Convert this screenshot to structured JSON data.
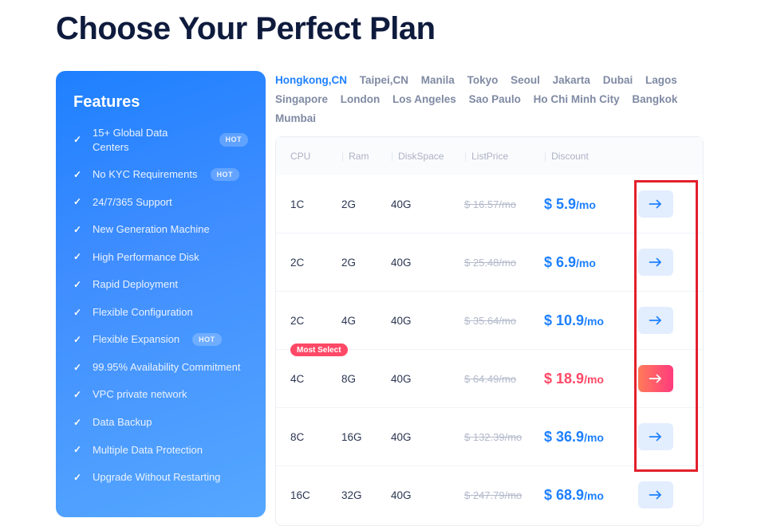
{
  "title": "Choose Your Perfect Plan",
  "features": {
    "heading": "Features",
    "hot_label": "HOT",
    "items": [
      {
        "label": "15+ Global Data Centers",
        "hot": true
      },
      {
        "label": "No KYC Requirements",
        "hot": true
      },
      {
        "label": "24/7/365 Support",
        "hot": false
      },
      {
        "label": "New Generation Machine",
        "hot": false
      },
      {
        "label": "High Performance Disk",
        "hot": false
      },
      {
        "label": "Rapid Deployment",
        "hot": false
      },
      {
        "label": "Flexible Configuration",
        "hot": false
      },
      {
        "label": "Flexible Expansion",
        "hot": true
      },
      {
        "label": "99.95% Availability Commitment",
        "hot": false
      },
      {
        "label": "VPC private network",
        "hot": false
      },
      {
        "label": "Data Backup",
        "hot": false
      },
      {
        "label": "Multiple Data Protection",
        "hot": false
      },
      {
        "label": "Upgrade Without Restarting",
        "hot": false
      }
    ]
  },
  "locations": {
    "active": 0,
    "items": [
      "Hongkong,CN",
      "Taipei,CN",
      "Manila",
      "Tokyo",
      "Seoul",
      "Jakarta",
      "Dubai",
      "Lagos",
      "Singapore",
      "London",
      "Los Angeles",
      "Sao Paulo",
      "Ho Chi Minh City",
      "Bangkok",
      "Mumbai"
    ]
  },
  "table": {
    "headers": {
      "cpu": "CPU",
      "ram": "Ram",
      "disk": "DiskSpace",
      "list": "ListPrice",
      "discount": "Discount"
    },
    "most_select_label": "Most Select",
    "rows": [
      {
        "cpu": "1C",
        "ram": "2G",
        "disk": "40G",
        "list": "$ 16.57/mo",
        "discount_prefix": "$ ",
        "discount_value": "5.9",
        "discount_suffix": "/mo",
        "highlight": false
      },
      {
        "cpu": "2C",
        "ram": "2G",
        "disk": "40G",
        "list": "$ 25.48/mo",
        "discount_prefix": "$ ",
        "discount_value": "6.9",
        "discount_suffix": "/mo",
        "highlight": false
      },
      {
        "cpu": "2C",
        "ram": "4G",
        "disk": "40G",
        "list": "$ 35.64/mo",
        "discount_prefix": "$ ",
        "discount_value": "10.9",
        "discount_suffix": "/mo",
        "highlight": false
      },
      {
        "cpu": "4C",
        "ram": "8G",
        "disk": "40G",
        "list": "$ 64.49/mo",
        "discount_prefix": "$ ",
        "discount_value": "18.9",
        "discount_suffix": "/mo",
        "highlight": true
      },
      {
        "cpu": "8C",
        "ram": "16G",
        "disk": "40G",
        "list": "$ 132.39/mo",
        "discount_prefix": "$ ",
        "discount_value": "36.9",
        "discount_suffix": "/mo",
        "highlight": false
      },
      {
        "cpu": "16C",
        "ram": "32G",
        "disk": "40G",
        "list": "$ 247.79/mo",
        "discount_prefix": "$ ",
        "discount_value": "68.9",
        "discount_suffix": "/mo",
        "highlight": false
      }
    ]
  }
}
